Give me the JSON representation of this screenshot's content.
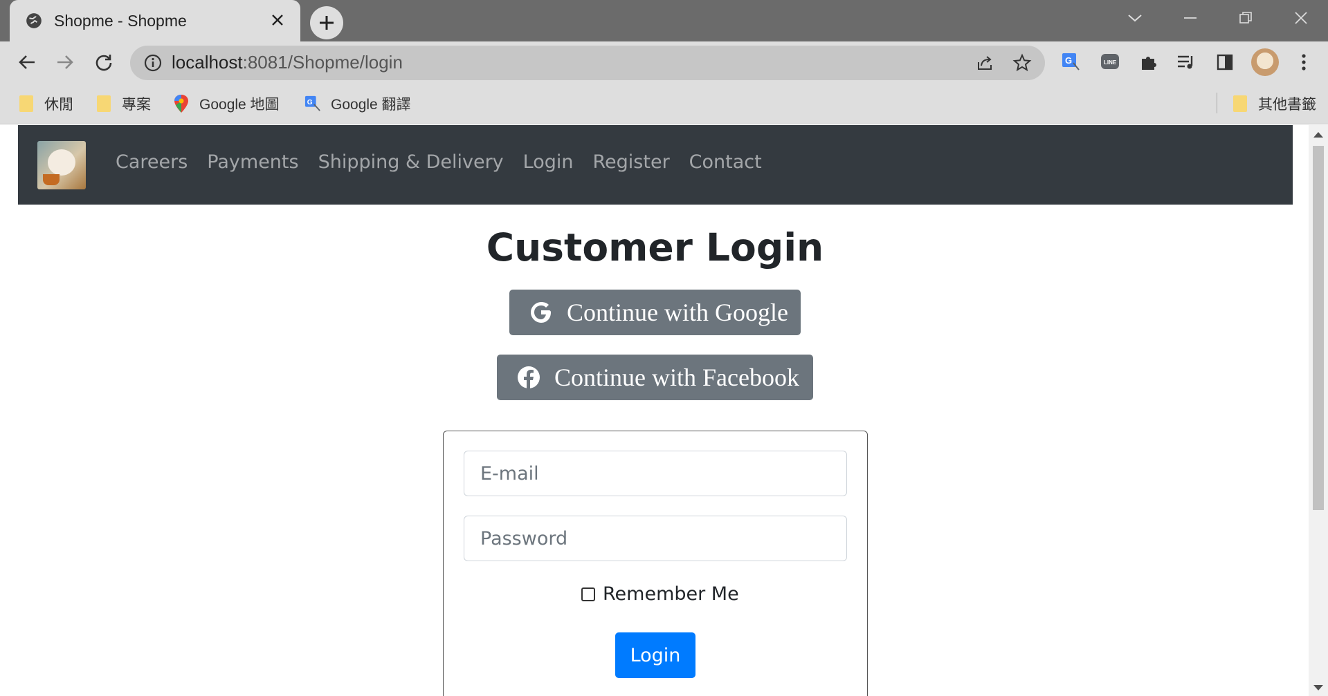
{
  "browser": {
    "tab": {
      "title": "Shopme - Shopme"
    },
    "address": {
      "host": "localhost",
      "path": ":8081/Shopme/login"
    },
    "bookmarks": [
      {
        "label": "休閒",
        "icon": "folder-icon"
      },
      {
        "label": "專案",
        "icon": "folder-icon"
      },
      {
        "label": "Google 地圖",
        "icon": "google-maps-icon"
      },
      {
        "label": "Google 翻譯",
        "icon": "google-translate-icon"
      }
    ],
    "other_bookmarks": "其他書籤"
  },
  "navbar": {
    "links": [
      "Careers",
      "Payments",
      "Shipping & Delivery",
      "Login",
      "Register",
      "Contact"
    ]
  },
  "main": {
    "heading": "Customer Login",
    "google_button": "Continue with Google",
    "facebook_button": "Continue with Facebook",
    "form": {
      "email_placeholder": "E-mail",
      "password_placeholder": "Password",
      "remember_label": "Remember Me",
      "remember_checked": false,
      "submit_label": "Login"
    }
  },
  "colors": {
    "navbar_bg": "#343a40",
    "social_button_bg": "#6c757d",
    "primary": "#007bff",
    "tabstrip": "#6b6b6b",
    "chrome": "#dedede"
  }
}
